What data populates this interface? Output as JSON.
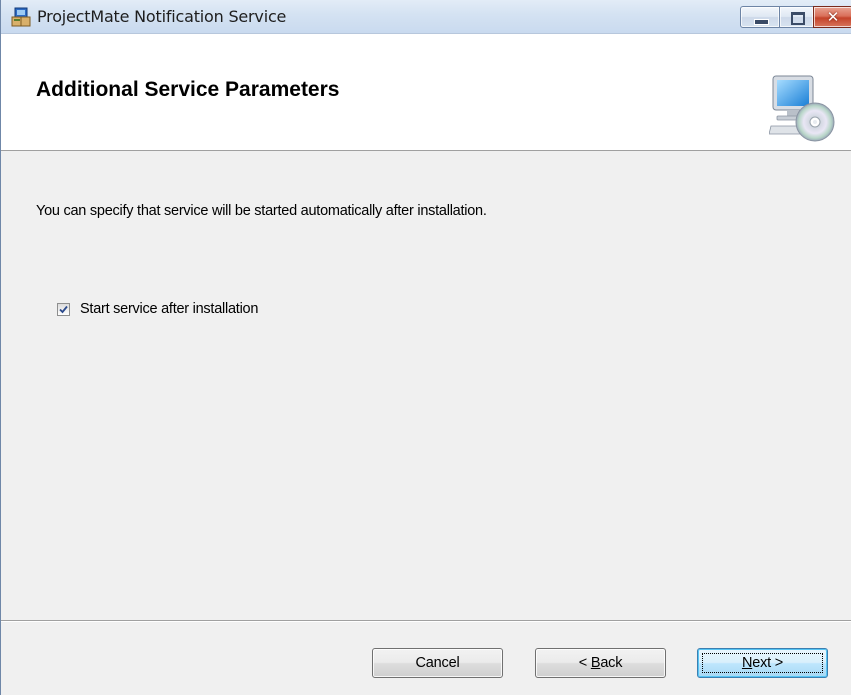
{
  "window": {
    "title": "ProjectMate Notification Service",
    "icon": "installer-icon",
    "controls": [
      "minimize",
      "maximize",
      "close"
    ]
  },
  "banner": {
    "title": "Additional Service Parameters",
    "icon": "computer-cd-icon"
  },
  "body": {
    "description": "You can specify that service will be started automatically after installation.",
    "checkbox": {
      "label": "Start service after installation",
      "checked": true
    }
  },
  "buttons": {
    "cancel": "Cancel",
    "back_prefix": "< ",
    "back_mnemonic": "B",
    "back_rest": "ack",
    "next_mnemonic": "N",
    "next_rest": "ext >"
  },
  "colors": {
    "dialog_bg": "#f0f0f0",
    "banner_bg": "#ffffff",
    "close_button": "#c4432a",
    "default_button_border": "#3c7fb1"
  }
}
